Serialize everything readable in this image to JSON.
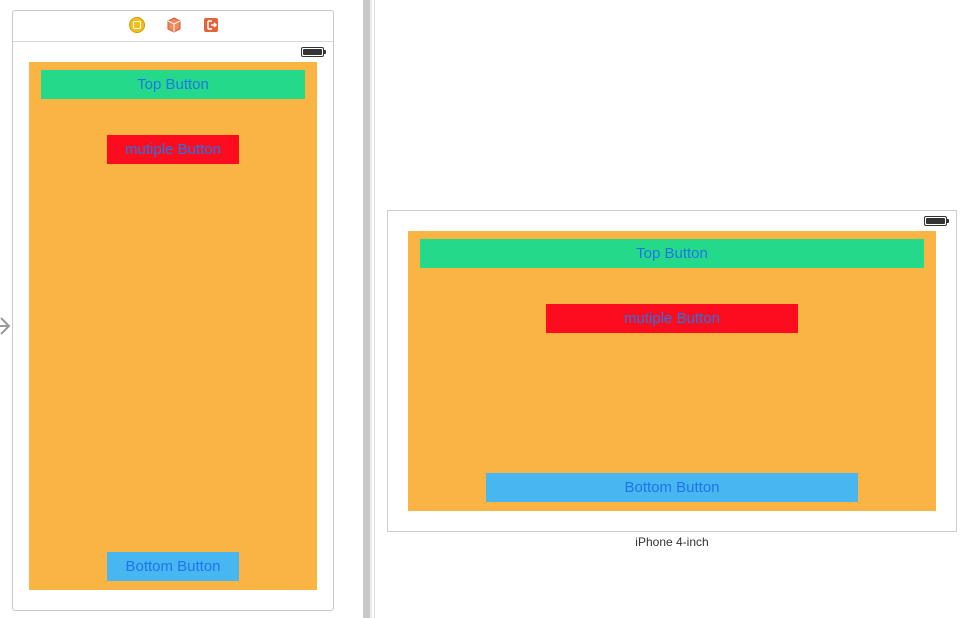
{
  "portrait_scene": {
    "dock_icons": [
      "view-controller-icon",
      "first-responder-icon",
      "exit-icon"
    ],
    "top_button": "Top Button",
    "multiple_button": "mutiple Button",
    "bottom_button": "Bottom Button"
  },
  "landscape_scene": {
    "top_button": "Top Button",
    "multiple_button": "mutiple Button",
    "bottom_button": "Bottom Button",
    "device_label": "iPhone 4-inch"
  },
  "colors": {
    "view_background": "#fab443",
    "top_button_bg": "#25d98a",
    "multiple_button_bg": "#fd0c1f",
    "bottom_button_bg": "#47b6f1",
    "button_text": "#1f76e8"
  }
}
